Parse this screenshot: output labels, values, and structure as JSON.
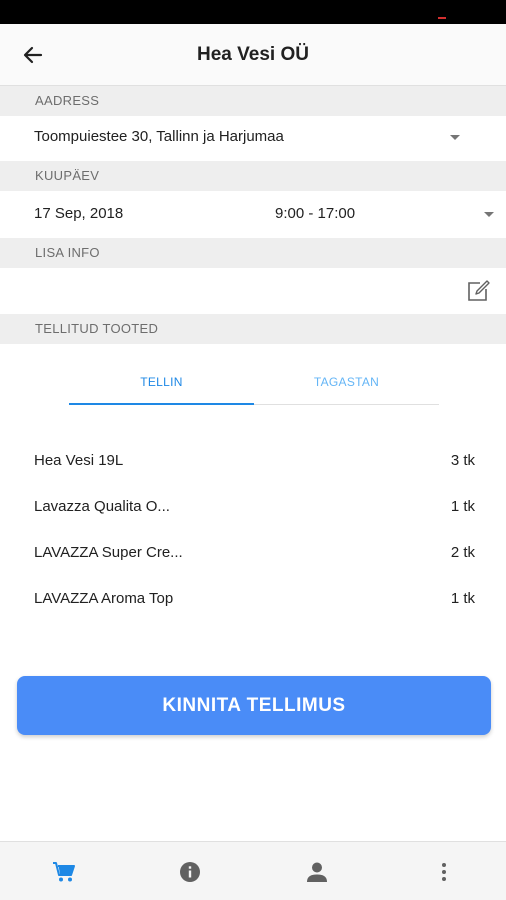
{
  "app_bar": {
    "title": "Hea Vesi OÜ"
  },
  "address": {
    "header": "AADRESS",
    "value": "Toompuiestee 30, Tallinn ja Harjumaa"
  },
  "date": {
    "header": "KUUPÄEV",
    "day": "17 Sep, 2018",
    "time": "9:00 - 17:00"
  },
  "info": {
    "header": "LISA INFO"
  },
  "ordered": {
    "header": "TELLITUD TOOTED",
    "tabs": [
      {
        "label": "TELLIN",
        "active": true
      },
      {
        "label": "TAGASTAN",
        "active": false
      }
    ],
    "items": [
      {
        "name": "Hea Vesi 19L",
        "qty": "3 tk"
      },
      {
        "name": "Lavazza Qualita O...",
        "qty": "1 tk"
      },
      {
        "name": "LAVAZZA Super Cre...",
        "qty": "2 tk"
      },
      {
        "name": "LAVAZZA Aroma Top",
        "qty": "1 tk"
      }
    ]
  },
  "confirm_label": "KINNITA TELLIMUS",
  "bottom_nav": [
    {
      "icon": "cart-icon",
      "active": true
    },
    {
      "icon": "info-icon",
      "active": false
    },
    {
      "icon": "person-icon",
      "active": false
    },
    {
      "icon": "more-vert-icon",
      "active": false
    }
  ],
  "colors": {
    "accent": "#1e88e5",
    "button": "#4a8cf7",
    "section_bg": "#eeeeee"
  }
}
